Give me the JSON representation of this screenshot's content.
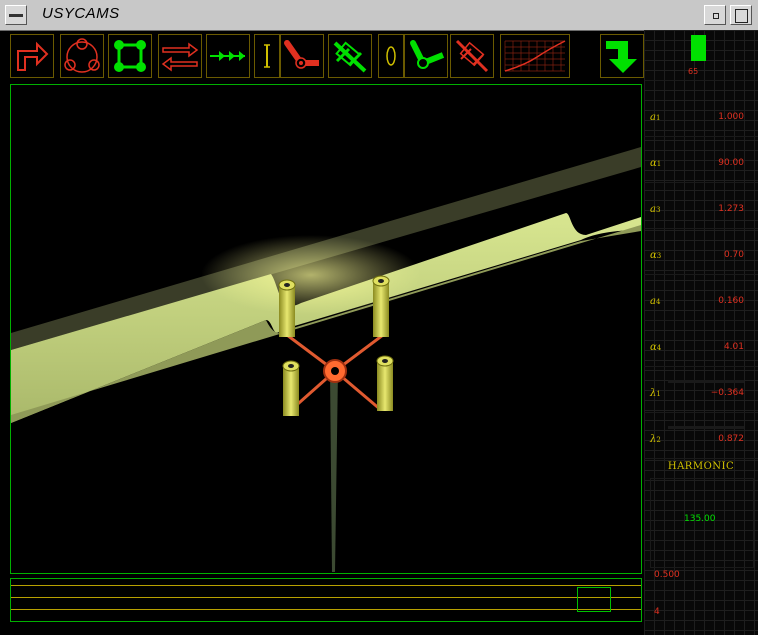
{
  "window": {
    "title": "USYCAMS"
  },
  "toolbar": {
    "tools": [
      {
        "name": "turn-right-arrow",
        "color": "#e03020"
      },
      {
        "name": "three-rollers",
        "color": "#e03020"
      },
      {
        "name": "four-rollers",
        "color": "#00e000"
      },
      {
        "name": "opposite-arrows",
        "color": "#e03020"
      },
      {
        "name": "dotted-arrow",
        "color": "#00e000"
      },
      {
        "name": "linear-link",
        "color": "#d0c000"
      },
      {
        "name": "rocker-link",
        "color": "#e03020"
      },
      {
        "name": "slider-crank",
        "color": "#00e000"
      },
      {
        "name": "ellipse",
        "color": "#d0c000"
      },
      {
        "name": "bent-link",
        "color": "#00e000"
      },
      {
        "name": "piston",
        "color": "#e03020"
      },
      {
        "name": "graph-grid",
        "color": "#e03020"
      },
      {
        "name": "down-arrow",
        "color": "#00e000"
      }
    ]
  },
  "indicator": {
    "value": "65"
  },
  "parameters": [
    {
      "symbol": "a",
      "sub": "1",
      "value": "1.000"
    },
    {
      "symbol": "α",
      "sub": "1",
      "value": "90.00"
    },
    {
      "symbol": "a",
      "sub": "3",
      "value": "1.273"
    },
    {
      "symbol": "α",
      "sub": "3",
      "value": "0.70"
    },
    {
      "symbol": "a",
      "sub": "4",
      "value": "0.160"
    },
    {
      "symbol": "α",
      "sub": "4",
      "value": "4.01"
    },
    {
      "symbol": "λ",
      "sub": "1",
      "value": "−0.364"
    },
    {
      "symbol": "λ",
      "sub": "2",
      "value": "0.872"
    }
  ],
  "harmonic": {
    "title": "HARMONIC",
    "value": "135.00",
    "low": "0.500",
    "count": "4"
  },
  "colors": {
    "accent_green": "#00e000",
    "accent_red": "#e03020",
    "accent_yellow": "#d0c000"
  }
}
